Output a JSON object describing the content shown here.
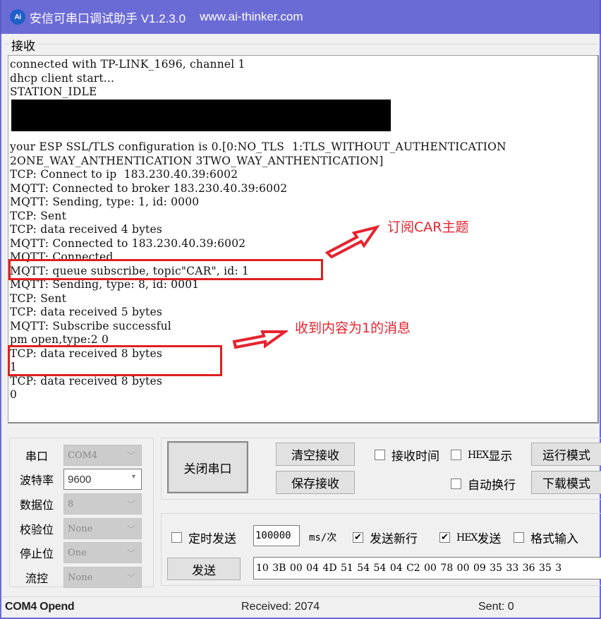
{
  "window": {
    "logo_text": "Ai",
    "title": "安信可串口调试助手 V1.2.3.0",
    "url": "www.ai-thinker.com"
  },
  "receive": {
    "group_label": "接收",
    "lines": [
      "connected with TP-LINK_1696, channel 1",
      "dhcp client start...",
      "STATION_IDLE",
      "",
      "",
      "",
      "your ESP SSL/TLS configuration is 0.[0:NO_TLS\t1:TLS_WITHOUT_AUTHENTICATION",
      "2ONE_WAY_ANTHENTICATION 3TWO_WAY_ANTHENTICATION]",
      "TCP: Connect to ip  183.230.40.39:6002",
      "MQTT: Connected to broker 183.230.40.39:6002",
      "MQTT: Sending, type: 1, id: 0000",
      "TCP: Sent",
      "TCP: data received 4 bytes",
      "MQTT: Connected to 183.230.40.39:6002",
      "MQTT: Connected",
      "MQTT: queue subscribe, topic\"CAR\", id: 1",
      "MQTT: Sending, type: 8, id: 0001",
      "TCP: Sent",
      "TCP: data received 5 bytes",
      "MQTT: Subscribe successful",
      "pm open,type:2 0",
      "TCP: data received 8 bytes",
      "1",
      "TCP: data received 8 bytes",
      "0"
    ]
  },
  "annotations": {
    "subscribe_note": "订阅CAR主题",
    "message_note": "收到内容为1的消息",
    "color": "#e6232f"
  },
  "port_settings": {
    "rows": [
      {
        "label": "串口",
        "value": "COM4",
        "enabled": false
      },
      {
        "label": "波特率",
        "value": "9600",
        "enabled": true
      },
      {
        "label": "数据位",
        "value": "8",
        "enabled": false
      },
      {
        "label": "校验位",
        "value": "None",
        "enabled": false
      },
      {
        "label": "停止位",
        "value": "One",
        "enabled": false
      },
      {
        "label": "流控",
        "value": "None",
        "enabled": false
      }
    ]
  },
  "controls": {
    "close_port": "关闭串口",
    "clear_receive": "清空接收",
    "save_receive": "保存接收",
    "recv_time": {
      "label": "接收时间",
      "checked": false
    },
    "hex_display": {
      "prefix": "HEX",
      "label": "显示",
      "checked": false
    },
    "auto_wrap": {
      "label": "自动换行",
      "checked": false
    },
    "run_mode": "运行模式",
    "download_mode": "下载模式"
  },
  "send": {
    "timed_send": {
      "label": "定时发送",
      "checked": false
    },
    "interval_value": "100000",
    "interval_unit": "ms/次",
    "send_newline": {
      "label": "发送新行",
      "checked": true
    },
    "hex_send": {
      "prefix": "HEX",
      "label": "发送",
      "checked": true
    },
    "format_input": {
      "label": "格式输入",
      "checked": false
    },
    "send_button": "发送",
    "payload": "10 3B 00 04 4D 51 54 54 04 C2 00 78 00 09 35 33 36 35 3"
  },
  "status": {
    "port_state": "COM4 Opend",
    "received": "Received: 2074",
    "sent": "Sent: 0"
  },
  "icons": {
    "checkmark": "✔",
    "chevron": "﹀",
    "dropdown": "▾"
  }
}
